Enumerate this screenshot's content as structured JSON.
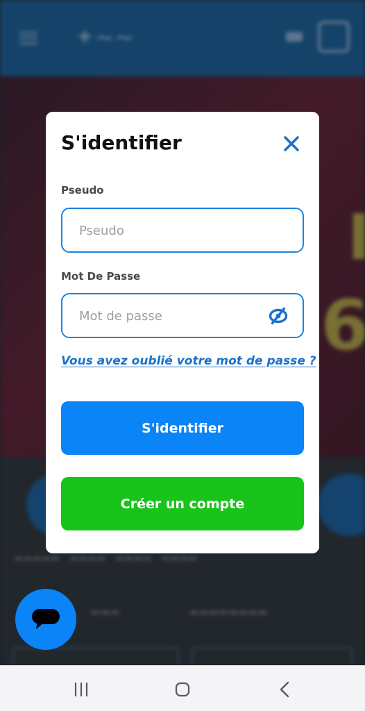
{
  "modal": {
    "title": "S'identifier",
    "username": {
      "label": "Pseudo",
      "placeholder": "Pseudo",
      "value": ""
    },
    "password": {
      "label": "Mot De Passe",
      "placeholder": "Mot de passe",
      "value": ""
    },
    "forgot_link": "Vous avez oublié votre mot de passe ?",
    "login_button": "S'identifier",
    "create_account_button": "Créer un compte"
  },
  "icons": {
    "close": "close-icon",
    "password_toggle": "eye-slash-icon",
    "chat": "chat-bubble-icon",
    "nav_recent": "recent-apps-icon",
    "nav_home": "home-icon",
    "nav_back": "back-icon"
  },
  "colors": {
    "primary_blue": "#0a84f7",
    "input_border": "#1a84e0",
    "link_blue": "#1a72c9",
    "create_green": "#19c41a",
    "title_text": "#111111"
  }
}
